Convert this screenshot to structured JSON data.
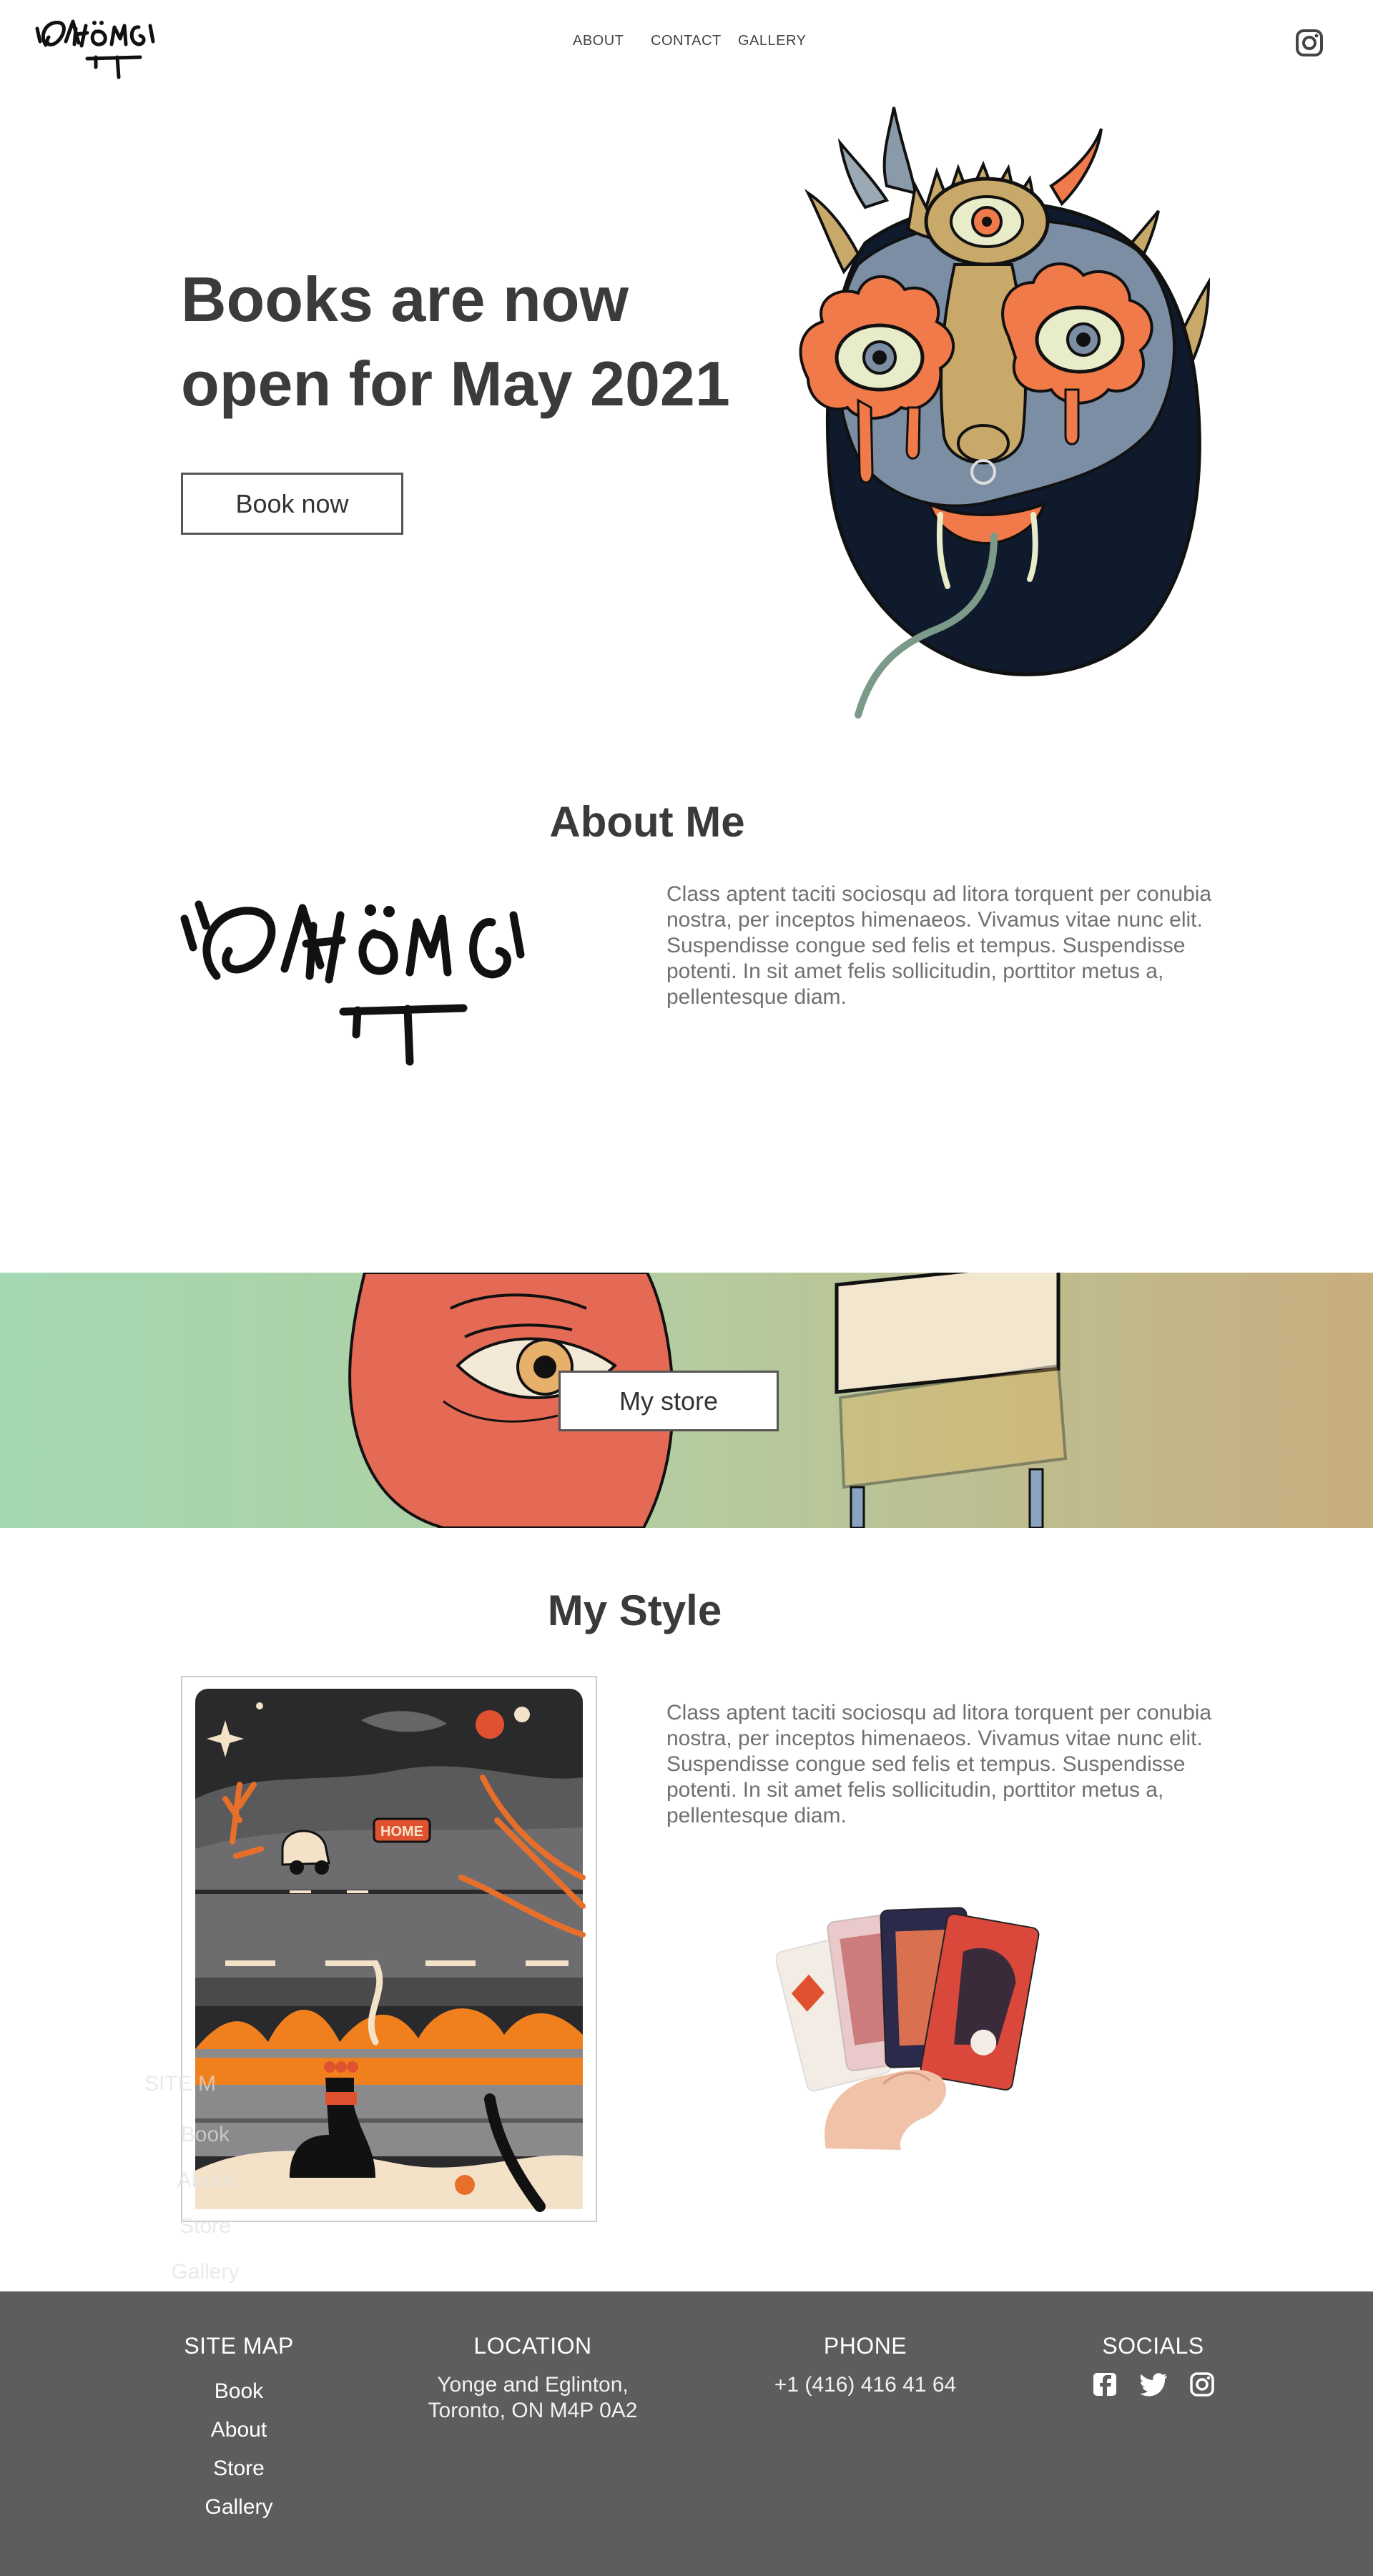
{
  "nav": {
    "about": "ABOUT",
    "contact": "CONTACT",
    "gallery": "GALLERY"
  },
  "hero": {
    "title_line1": "Books are now",
    "title_line2": "open for May 2021",
    "button": "Book now"
  },
  "about": {
    "title": "About Me",
    "text": "Class aptent taciti sociosqu ad litora torquent per conubia nostra, per inceptos himenaeos. Vivamus vitae nunc elit. Suspendisse congue sed felis et tempus. Suspendisse potenti. In sit amet felis sollicitudin, porttitor metus a, pellentesque diam."
  },
  "banner": {
    "button": "My store"
  },
  "style": {
    "title": "My Style",
    "text": "Class aptent taciti sociosqu ad litora torquent per conubia nostra, per inceptos himenaeos. Vivamus vitae nunc elit. Suspendisse congue sed felis et tempus. Suspendisse potenti. In sit amet felis sollicitudin, porttitor metus a, pellentesque diam.",
    "card_sign": "HOME"
  },
  "ghost_sitemap": {
    "title": "SITE M",
    "items": [
      "Book",
      "About",
      "Store",
      "Gallery"
    ]
  },
  "footer": {
    "sitemap": {
      "title": "SITE MAP",
      "items": [
        "Book",
        "About",
        "Store",
        "Gallery"
      ]
    },
    "location": {
      "title": "LOCATION",
      "line1": "Yonge and Eglinton,",
      "line2": "Toronto, ON M4P 0A2"
    },
    "phone": {
      "title": "PHONE",
      "number": "+1 (416) 416 41 64"
    },
    "socials": {
      "title": "SOCIALS",
      "icons": [
        "facebook-icon",
        "twitter-icon",
        "instagram-icon"
      ]
    }
  },
  "colors": {
    "text_dark": "#3a3a3a",
    "text_grey": "#707070",
    "footer_bg": "#5e5c5e",
    "banner_left": "#a3d8b3",
    "banner_right": "#c8ad7f",
    "accent_orange": "#f07a4a"
  }
}
